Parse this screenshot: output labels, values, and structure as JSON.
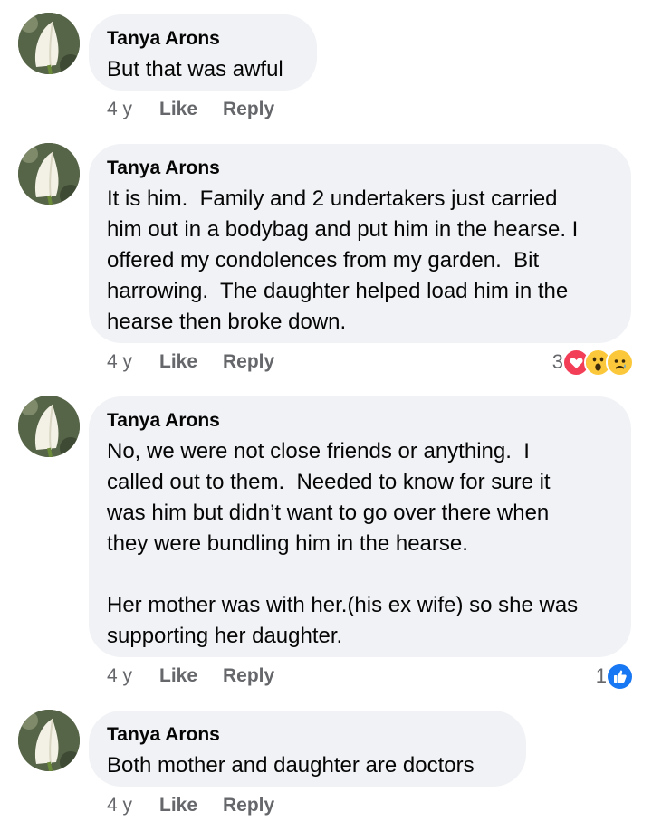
{
  "comments": [
    {
      "author": "Tanya Arons",
      "text": "But that was awful",
      "age": "4 y",
      "like": "Like",
      "reply": "Reply",
      "reaction_count": null,
      "reactions": []
    },
    {
      "author": "Tanya Arons",
      "text": "It is him.  Family and 2 undertakers just carried\nhim out in a bodybag and put him in the hearse. I\noffered my condolences from my garden.  Bit\nharrowing.  The daughter helped load him in the\nhearse then broke down.",
      "age": "4 y",
      "like": "Like",
      "reply": "Reply",
      "reaction_count": "3",
      "reactions": [
        "love-reaction-icon",
        "wow-reaction-icon",
        "sad-reaction-icon"
      ]
    },
    {
      "author": "Tanya Arons",
      "text": "No, we were not close friends or anything.  I\ncalled out to them.  Needed to know for sure it\nwas him but didn’t want to go over there when\nthey were bundling him in the hearse.\n\nHer mother was with her.(his ex wife) so she was\nsupporting her daughter.",
      "age": "4 y",
      "like": "Like",
      "reply": "Reply",
      "reaction_count": "1",
      "reactions": [
        "like-reaction-icon"
      ]
    },
    {
      "author": "Tanya Arons",
      "text": "Both mother and daughter are doctors",
      "age": "4 y",
      "like": "Like",
      "reply": "Reply",
      "reaction_count": null,
      "reactions": []
    }
  ],
  "colors": {
    "bubble": "#f0f2f5",
    "meta_text": "#65676b",
    "love": "#f33e58",
    "like": "#1877f2",
    "emoji": "#fcc83b"
  }
}
